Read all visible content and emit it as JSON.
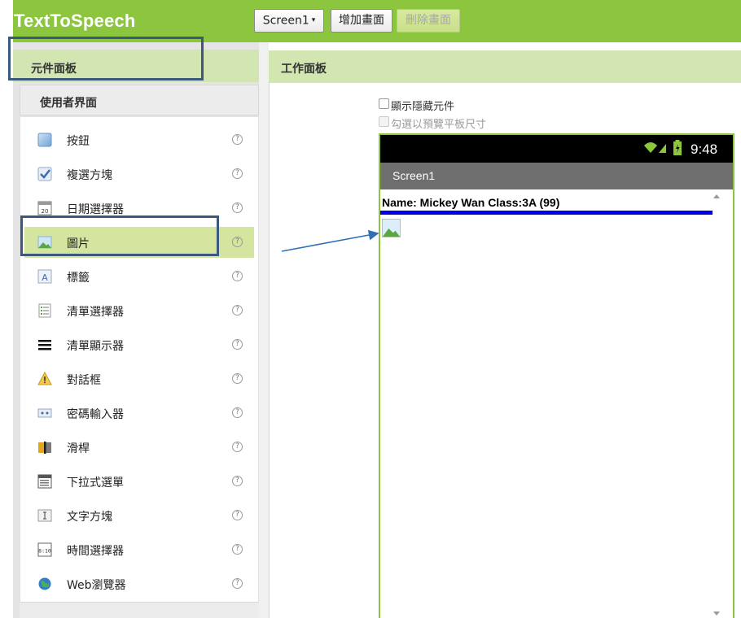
{
  "app": {
    "title": "TextToSpeech",
    "brand_color": "#8cc63f"
  },
  "toolbar": {
    "screen_select": "Screen1",
    "add_screen": "增加畫面",
    "remove_screen": "刪除畫面"
  },
  "palette": {
    "title": "元件面板",
    "category": "使用者界面",
    "items": [
      {
        "label": "按鈕",
        "icon": "button-icon"
      },
      {
        "label": "複選方塊",
        "icon": "checkbox-icon"
      },
      {
        "label": "日期選擇器",
        "icon": "date-picker-icon"
      },
      {
        "label": "圖片",
        "icon": "image-icon",
        "selected": true
      },
      {
        "label": "標籤",
        "icon": "label-icon"
      },
      {
        "label": "清單選擇器",
        "icon": "list-picker-icon"
      },
      {
        "label": "清單顯示器",
        "icon": "list-view-icon"
      },
      {
        "label": "對話框",
        "icon": "notifier-icon"
      },
      {
        "label": "密碼輸入器",
        "icon": "password-icon"
      },
      {
        "label": "滑桿",
        "icon": "slider-icon"
      },
      {
        "label": "下拉式選單",
        "icon": "spinner-icon"
      },
      {
        "label": "文字方塊",
        "icon": "textbox-icon"
      },
      {
        "label": "時間選擇器",
        "icon": "time-picker-icon"
      },
      {
        "label": "Web瀏覽器",
        "icon": "web-viewer-icon"
      }
    ],
    "help_symbol": "?"
  },
  "workspace": {
    "title": "工作面板",
    "show_hidden": "顯示隱藏元件",
    "tablet_preview": "勾選以預覽平板尺寸",
    "phone": {
      "time": "9:48",
      "screen_title": "Screen1",
      "name_label": "Name: Mickey Wan Class:3A (99)",
      "divider_color": "#0000e6"
    }
  },
  "annotation": {
    "color": "#3b587f"
  }
}
